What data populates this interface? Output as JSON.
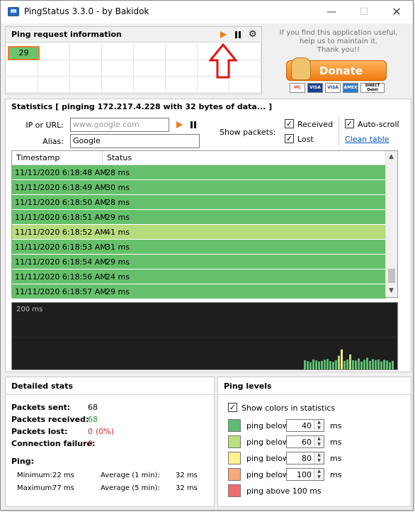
{
  "window": {
    "title": "PingStatus 3.3.0 - by Bakidok"
  },
  "ping_request": {
    "title": "Ping request information",
    "cells": [
      "29"
    ]
  },
  "donate": {
    "line1": "If you find this application useful,",
    "line2": "help us to maintain it.",
    "line3": "Thank you!!",
    "button_label": "Donate",
    "cards": [
      "MC",
      "VISA",
      "VISA",
      "AMEX",
      "DIRECT Debit"
    ]
  },
  "statistics": {
    "title": "Statistics  [ pinging 172.217.4.228 with 32 bytes of data... ]",
    "ip_label": "IP or URL:",
    "ip_placeholder": "www.google.com",
    "alias_label": "Alias:",
    "alias_value": "Google",
    "show_packets_label": "Show packets:",
    "received_label": "Received",
    "lost_label": "Lost",
    "autoscroll_label": "Auto-scroll",
    "clean_table_label": "Clean table",
    "columns": [
      "Timestamp",
      "Status"
    ],
    "rows": [
      {
        "timestamp": "11/11/2020  6:18:48 AM",
        "status": "28 ms"
      },
      {
        "timestamp": "11/11/2020  6:18:49 AM",
        "status": "30 ms"
      },
      {
        "timestamp": "11/11/2020  6:18:50 AM",
        "status": "28 ms"
      },
      {
        "timestamp": "11/11/2020  6:18:51 AM",
        "status": "29 ms"
      },
      {
        "timestamp": "11/11/2020  6:18:52 AM",
        "status": "41 ms"
      },
      {
        "timestamp": "11/11/2020  6:18:53 AM",
        "status": "31 ms"
      },
      {
        "timestamp": "11/11/2020  6:18:54 AM",
        "status": "29 ms"
      },
      {
        "timestamp": "11/11/2020  6:18:56 AM",
        "status": "24 ms"
      },
      {
        "timestamp": "11/11/2020  6:18:57 AM",
        "status": "29 ms"
      }
    ],
    "graph_label": "200 ms",
    "graph_values": [
      28,
      25,
      22,
      30,
      27,
      24,
      26,
      29,
      31,
      25,
      23,
      28,
      41,
      60,
      26,
      30,
      45,
      28,
      27,
      33,
      24,
      29,
      35,
      26,
      31,
      28,
      30,
      24,
      29,
      27,
      22,
      26
    ]
  },
  "detailed": {
    "title": "Detailed stats",
    "sent_label": "Packets sent:",
    "sent_value": "68",
    "received_label": "Packets received:",
    "received_value": "68",
    "lost_label": "Packets lost:",
    "lost_value": "0",
    "lost_pct": "(0%)",
    "failure_label": "Connection failure:",
    "failure_value": "0",
    "ping_label": "Ping:",
    "min_label": "Minimum:",
    "min_value": "22 ms",
    "max_label": "Maximum:",
    "max_value": "77 ms",
    "avg1_label": "Average (1 min):",
    "avg1_value": "32 ms",
    "avg5_label": "Average (5 min):",
    "avg5_value": "32 ms"
  },
  "levels": {
    "title": "Ping levels",
    "show_colors_label": "Show colors in statistics",
    "items": [
      {
        "label": "ping below",
        "value": "40",
        "unit": "ms",
        "color": "#5dbb72"
      },
      {
        "label": "ping below",
        "value": "60",
        "unit": "ms",
        "color": "#b9e07d"
      },
      {
        "label": "ping below",
        "value": "80",
        "unit": "ms",
        "color": "#fdf08d"
      },
      {
        "label": "ping below",
        "value": "100",
        "unit": "ms",
        "color": "#f9a97a"
      },
      {
        "label": "ping above 100 ms",
        "value": "",
        "unit": "",
        "color": "#f26d6d"
      }
    ]
  },
  "colors": {
    "row_green": "#66c06b",
    "row_light_green": "#b6dc7e",
    "accent_orange": "#ee7b14",
    "lost_red": "#c62828",
    "received_green": "#2e9d35"
  }
}
